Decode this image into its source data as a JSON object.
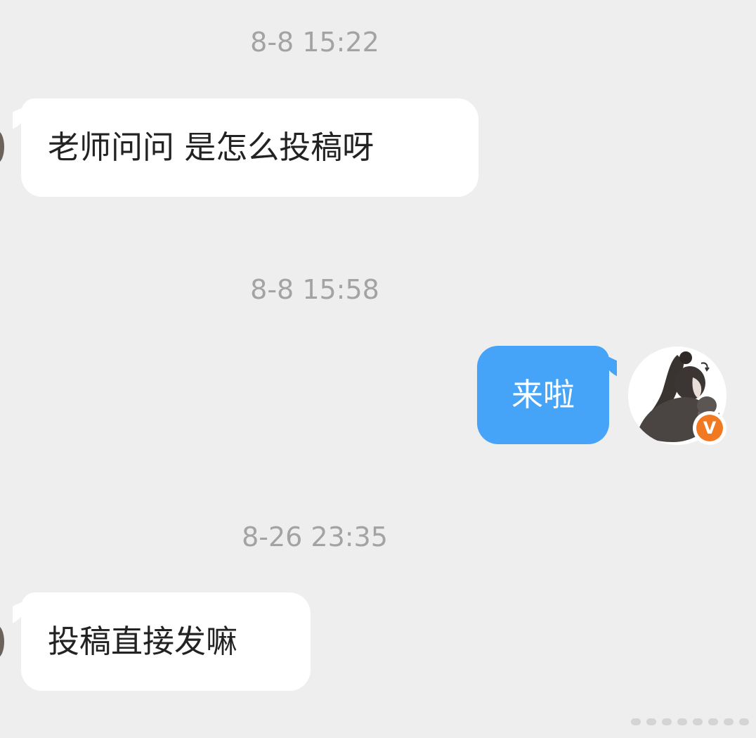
{
  "messages": [
    {
      "time": "8-8 15:22",
      "direction": "incoming",
      "text": "老师问问 是怎么投稿呀"
    },
    {
      "time": "8-8 15:58",
      "direction": "outgoing",
      "text": "来啦"
    },
    {
      "time": "8-26 23:35",
      "direction": "incoming",
      "text": "投稿直接发嘛"
    }
  ],
  "my_avatar": {
    "icon": "anime-character-avatar-icon",
    "badge_icon": "verified-v-icon",
    "badge_text": "V",
    "badge_color": "#f07921"
  },
  "colors": {
    "background": "#eeeeee",
    "incoming_bubble": "#ffffff",
    "outgoing_bubble": "#45a4f7",
    "timestamp": "#a3a3a3"
  }
}
